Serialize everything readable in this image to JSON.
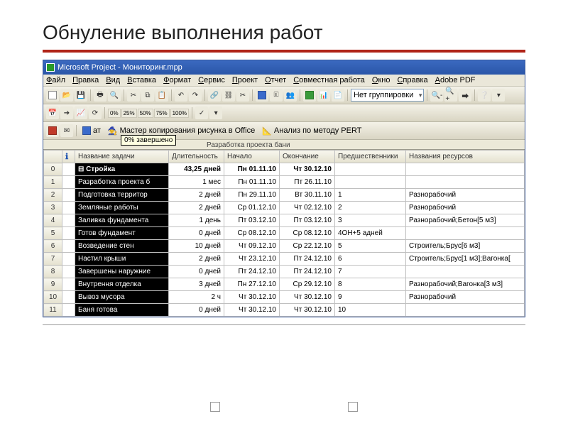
{
  "slide": {
    "title": "Обнуление выполнения работ"
  },
  "titlebar": {
    "text": "Microsoft Project - Мониторинг.mpp"
  },
  "menu": [
    "Файл",
    "Правка",
    "Вид",
    "Вставка",
    "Формат",
    "Сервис",
    "Проект",
    "Отчет",
    "Совместная работа",
    "Окно",
    "Справка",
    "Adobe PDF"
  ],
  "combo_group": "Нет группировки",
  "tooltip": "0% завершено",
  "sublabel": "Разработка проекта бани",
  "tb3": {
    "btn1": "ат",
    "btn2": "Мастер копирования рисунка в Office",
    "btn3": "Анализ по методу PERT"
  },
  "pct_buttons": [
    "0%",
    "25%",
    "50%",
    "75%",
    "100%"
  ],
  "columns": [
    "",
    "",
    "Название задачи",
    "Длительность",
    "Начало",
    "Окончание",
    "Предшественники",
    "Названия ресурсов"
  ],
  "info_header_icon": "ℹ",
  "rows": [
    {
      "n": "0",
      "task": "Стройка",
      "dur": "43,25 дней",
      "start": "Пн 01.11.10",
      "end": "Чт 30.12.10",
      "pred": "",
      "res": "",
      "style": "dark-bold",
      "rowbold": true
    },
    {
      "n": "1",
      "task": "Разработка проекта б",
      "dur": "1 мес",
      "start": "Пн 01.11.10",
      "end": "Пт 26.11.10",
      "pred": "",
      "res": "",
      "style": "dark"
    },
    {
      "n": "2",
      "task": "Подготовка территор",
      "dur": "2 дней",
      "start": "Пн 29.11.10",
      "end": "Вт 30.11.10",
      "pred": "1",
      "res": "Разнорабочий",
      "style": "dark"
    },
    {
      "n": "3",
      "task": "Земляные работы",
      "dur": "2 дней",
      "start": "Ср 01.12.10",
      "end": "Чт 02.12.10",
      "pred": "2",
      "res": "Разнорабочий",
      "style": "dark"
    },
    {
      "n": "4",
      "task": "Заливка фундамента",
      "dur": "1 день",
      "start": "Пт 03.12.10",
      "end": "Пт 03.12.10",
      "pred": "3",
      "res": "Разнорабочий;Бетон[5 м3]",
      "style": "dark"
    },
    {
      "n": "5",
      "task": "Готов фундамент",
      "dur": "0 дней",
      "start": "Ср 08.12.10",
      "end": "Ср 08.12.10",
      "pred": "4ОН+5 адней",
      "res": "",
      "style": "dark"
    },
    {
      "n": "6",
      "task": "Возведение стен",
      "dur": "10 дней",
      "start": "Чт 09.12.10",
      "end": "Ср 22.12.10",
      "pred": "5",
      "res": "Строитель;Брус[6 м3]",
      "style": "dark"
    },
    {
      "n": "7",
      "task": "Настил крыши",
      "dur": "2 дней",
      "start": "Чт 23.12.10",
      "end": "Пт 24.12.10",
      "pred": "6",
      "res": "Строитель;Брус[1 м3];Вагонка[",
      "style": "dark"
    },
    {
      "n": "8",
      "task": "Завершены наружние",
      "dur": "0 дней",
      "start": "Пт 24.12.10",
      "end": "Пт 24.12.10",
      "pred": "7",
      "res": "",
      "style": "dark"
    },
    {
      "n": "9",
      "task": "Внутрення отделка",
      "dur": "3 дней",
      "start": "Пн 27.12.10",
      "end": "Ср 29.12.10",
      "pred": "8",
      "res": "Разнорабочий;Вагонка[3 м3]",
      "style": "dark"
    },
    {
      "n": "10",
      "task": "Вывоз мусора",
      "dur": "2 ч",
      "start": "Чт 30.12.10",
      "end": "Чт 30.12.10",
      "pred": "9",
      "res": "Разнорабочий",
      "style": "dark"
    },
    {
      "n": "11",
      "task": "Баня готова",
      "dur": "0 дней",
      "start": "Чт 30.12.10",
      "end": "Чт 30.12.10",
      "pred": "10",
      "res": "",
      "style": "dark"
    }
  ]
}
